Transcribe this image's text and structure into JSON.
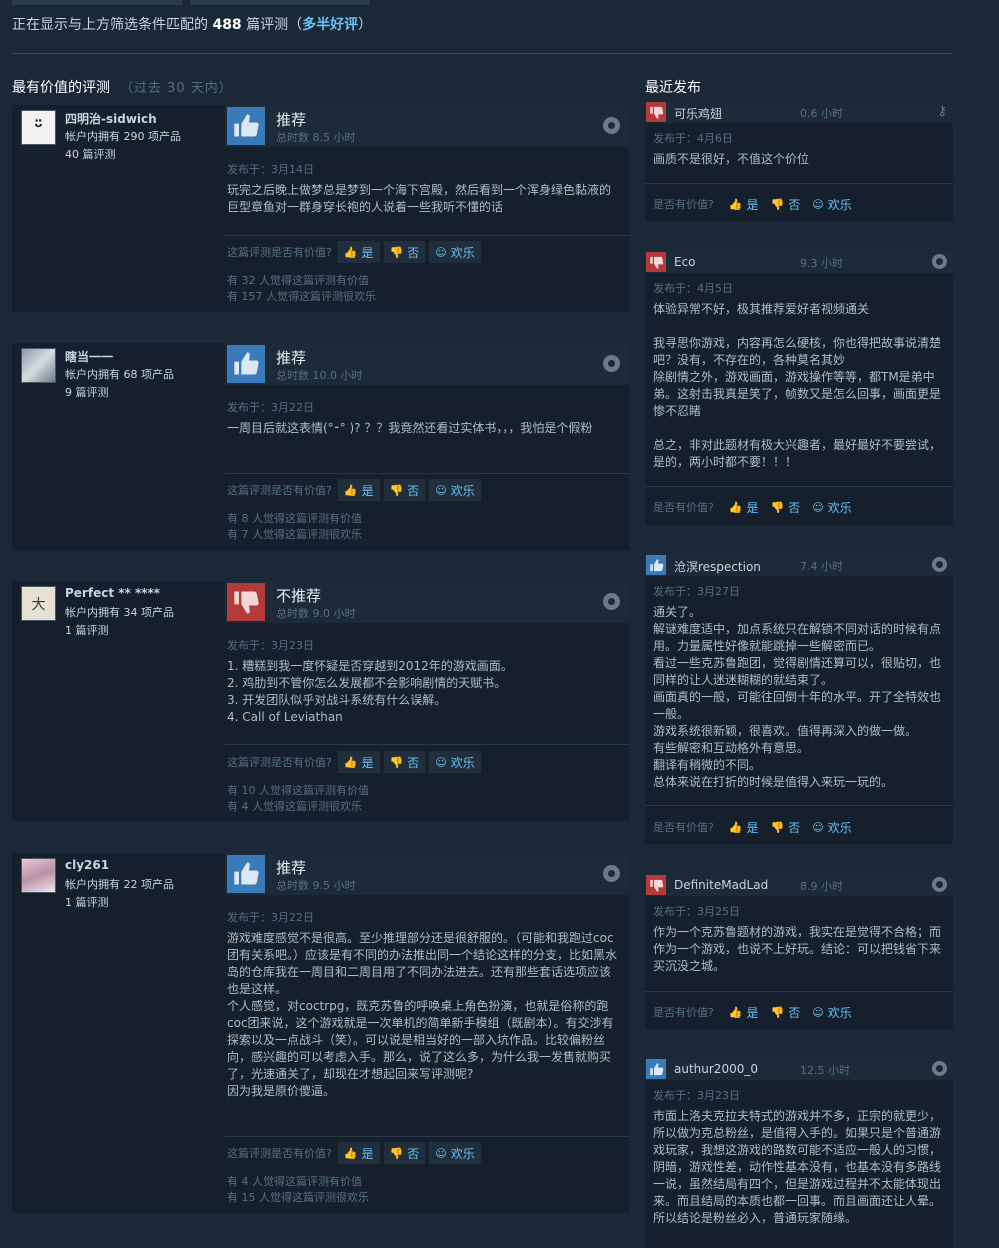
{
  "summary": {
    "prefix": "正在显示与上方筛选条件匹配的",
    "count": "488",
    "mid": "篇评测（",
    "rating": "多半好评",
    "suffix": "）"
  },
  "sections": {
    "helpful_title": "最有价值的评测",
    "helpful_sub": "（过去 30 天内）",
    "recent_title": "最近发布"
  },
  "labels": {
    "was_helpful": "这篇评测是否有价值?",
    "was_helpful_short": "是否有价值?",
    "yes": "是",
    "no": "否",
    "funny": "欢乐"
  },
  "colors": {
    "background": "#1b2838",
    "panel": "#16202d",
    "recommended": "#3a7ab8",
    "not_recommended": "#b33a3a",
    "link": "#67c1f5"
  },
  "reviews": [
    {
      "name": "四明治-sidwich",
      "owned": "帐户内拥有 290 项产品",
      "count": "40 篇评测",
      "verdict": "推荐",
      "hours": "总时数 8.5 小时",
      "date": "发布于：3月14日",
      "body": [
        "玩完之后晚上做梦总是梦到一个海下宫殿，然后看到一个浑身绿色黏液的巨型章鱼对一群身穿长袍的人说着一些我听不懂的话"
      ],
      "helpful": "有 32 人觉得这篇评测有价值",
      "funny": "有 157 人觉得这篇评测很欢乐"
    },
    {
      "name": "瞎当一一",
      "owned": "帐户内拥有 68 项产品",
      "count": "9 篇评测",
      "verdict": "推荐",
      "hours": "总时数 10.0 小时",
      "date": "发布于：3月22日",
      "body": [
        "一周目后就这表情(°⁃° )? ？？我竟然还看过实体书，，，我怕是个假粉"
      ],
      "helpful": "有 8 人觉得这篇评测有价值",
      "funny": "有 7 人觉得这篇评测很欢乐"
    },
    {
      "name": "Perfect ** ****",
      "owned": "帐户内拥有 34 项产品",
      "count": "1 篇评测",
      "verdict": "不推荐",
      "hours": "总时数 9.0 小时",
      "date": "发布于：3月23日",
      "body": [
        "1. 糟糕到我一度怀疑是否穿越到2012年的游戏画面。",
        "2. 鸡肋到不管你怎么发展都不会影响剧情的天赋书。",
        "3. 开发团队似乎对战斗系统有什么误解。",
        "4. Call of Leviathan"
      ],
      "helpful": "有 10 人觉得这篇评测有价值",
      "funny": "有 4 人觉得这篇评测很欢乐"
    },
    {
      "name": "cly261",
      "owned": "帐户内拥有 22 项产品",
      "count": "1 篇评测",
      "verdict": "推荐",
      "hours": "总时数 9.5 小时",
      "date": "发布于：3月22日",
      "body": [
        "游戏难度感觉不是很高。至少推理部分还是很舒服的。（可能和我跑过coc团有关系吧。）应该是有不同的办法推出同一个结论这样的分支，比如黑水岛的仓库我在一周目和二周目用了不同办法进去。还有那些套话选项应该也是这样。",
        "个人感觉，对coctrpg，既克苏鲁的呼唤桌上角色扮演，也就是俗称的跑coc团来说，这个游戏就是一次单机的简单新手模组（既剧本）。有交涉有探索以及一点战斗（笑）。可以说是相当好的一部入坑作品。比较偏粉丝向，感兴趣的可以考虑入手。那么，说了这么多，为什么我一发售就购买了，光速通关了，却现在才想起回来写评测呢?",
        "因为我是原价傻逼。"
      ],
      "helpful": "有 4 人觉得这篇评测有价值",
      "funny": "有 15 人觉得这篇评测很欢乐"
    }
  ],
  "recent": [
    {
      "name": "可乐鸡翅",
      "hours": "0.6 小时",
      "verdict": "down",
      "date": "发布于：4月6日",
      "body": [
        "画质不是很好，不值这个价位"
      ]
    },
    {
      "name": "Eco",
      "hours": "9.3 小时",
      "verdict": "down",
      "date": "发布于：4月5日",
      "body": [
        "体验异常不好，极其推荐爱好者视频通关",
        "",
        "我寻思你游戏，内容再怎么硬核，你也得把故事说清楚吧？没有，不存在的，各种莫名其妙",
        "除剧情之外，游戏画面，游戏操作等等，都TM是弟中弟。这射击我真是笑了，帧数又是怎么回事，画面更是惨不忍睹",
        "",
        "总之，非对此题材有极大兴趣者，最好最好不要尝试，是的，两小时都不要！！！"
      ]
    },
    {
      "name": "沧溟respection",
      "hours": "7.4 小时",
      "verdict": "up",
      "date": "发布于：3月27日",
      "body": [
        "通关了。",
        "解谜难度适中，加点系统只在解锁不同对话的时候有点用。力量属性好像就能跳掉一些解密而已。",
        "看过一些克苏鲁跑团，觉得剧情还算可以，很贴切，也同样的让人迷迷糊糊的就结束了。",
        "画面真的一般，可能往回倒十年的水平。开了全特效也一般。",
        "游戏系统很新颖，很喜欢。值得再深入的做一做。",
        "有些解密和互动格外有意思。",
        "翻译有稍微的不同。",
        "总体来说在打折的时候是值得入来玩一玩的。"
      ]
    },
    {
      "name": "DefiniteMadLad",
      "hours": "8.9 小时",
      "verdict": "down",
      "date": "发布于：3月25日",
      "body": [
        "作为一个克苏鲁题材的游戏，我实在是觉得不合格；而作为一个游戏，也说不上好玩。结论：可以把钱省下来买沉没之城。"
      ]
    },
    {
      "name": "authur2000_0",
      "hours": "12.5 小时",
      "verdict": "up",
      "date": "发布于：3月23日",
      "body": [
        "市面上洛夫克拉夫特式的游戏并不多，正宗的就更少，所以做为克总粉丝，是值得入手的。如果只是个普通游戏玩家，我想这游戏的路数可能不适应一般人的习惯，阴暗，游戏性差，动作性基本没有，也基本没有多路线一说，虽然结局有四个，但是游戏过程并不太能体现出来。而且结局的本质也都一回事。而且画面还让人晕。所以结论是粉丝必入，普通玩家随缘。"
      ]
    }
  ]
}
